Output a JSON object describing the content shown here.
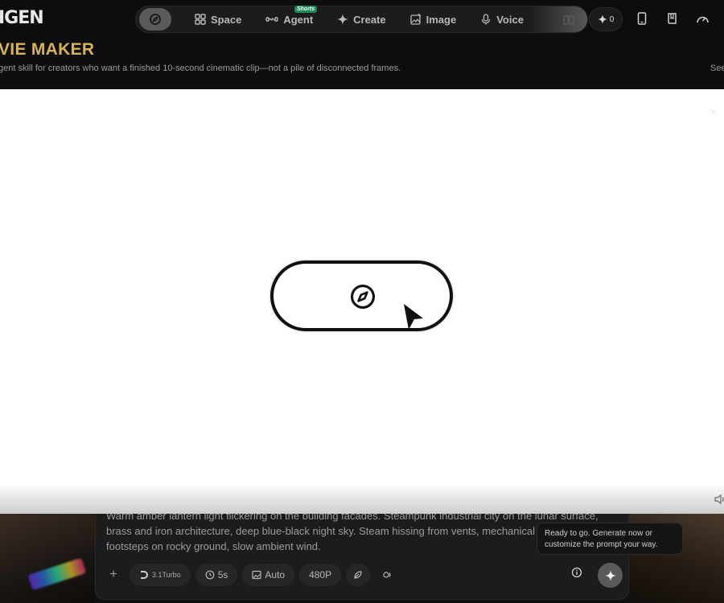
{
  "app": {
    "logo_text": "IGEN"
  },
  "nav": {
    "items": [
      {
        "label": "Space",
        "icon": "grid-icon"
      },
      {
        "label": "Agent",
        "icon": "infinity-icon",
        "badge": "Shorts"
      },
      {
        "label": "Create",
        "icon": "sparkle-icon"
      },
      {
        "label": "Image",
        "icon": "image-edit-icon"
      },
      {
        "label": "Voice",
        "icon": "mic-icon"
      }
    ],
    "credits": "0"
  },
  "header": {
    "title": "VIE MAKER",
    "description": "gent skill for creators who want a finished 10-second cinematic clip—not a pile of disconnected frames.",
    "right_text": "See"
  },
  "modal": {
    "close_label": "×"
  },
  "prompt": {
    "text": "Warm amber lantern light flickering on the building facades. Steampunk industrial city on the lunar surface, brass and iron architecture, deep blue-black night sky. Steam hissing from vents, mechanical rumbling, footsteps on rocky ground, slow ambient wind."
  },
  "toolbar": {
    "model": "3.1Turbo",
    "duration": "5s",
    "aspect": "Auto",
    "resolution": "480P"
  },
  "tooltip": {
    "text": "Ready to go. Generate now or customize the prompt your way."
  },
  "colors": {
    "accent_gold": "#d8b25a",
    "badge_green": "#1f8a5a"
  }
}
